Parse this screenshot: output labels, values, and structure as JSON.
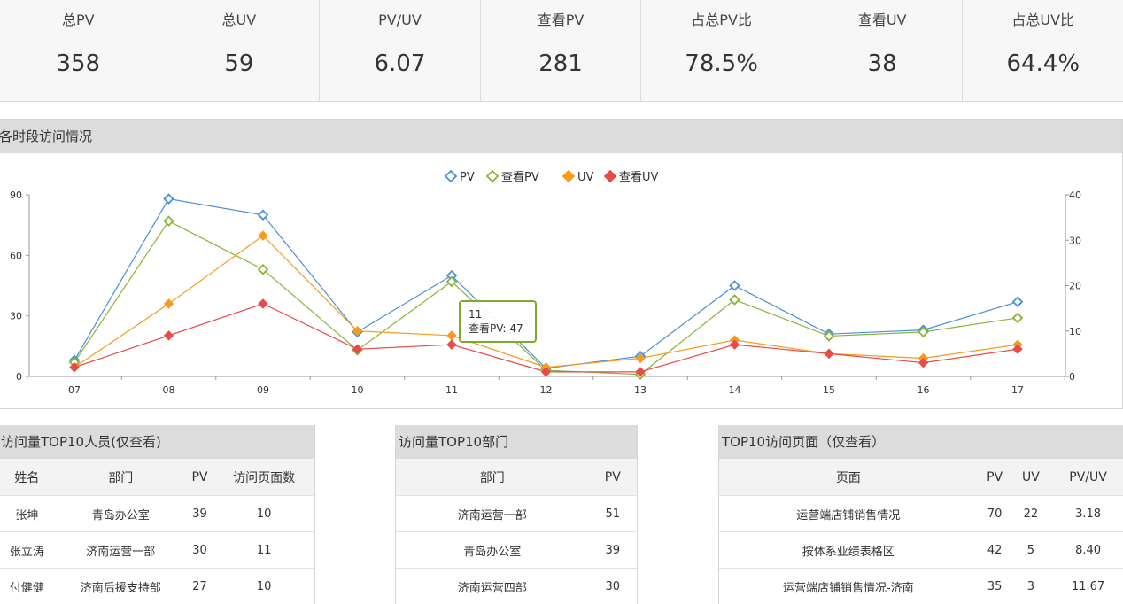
{
  "stats": [
    {
      "label": "总PV",
      "value": "358"
    },
    {
      "label": "总UV",
      "value": "59"
    },
    {
      "label": "PV/UV",
      "value": "6.07"
    },
    {
      "label": "查看PV",
      "value": "281"
    },
    {
      "label": "占总PV比",
      "value": "78.5%"
    },
    {
      "label": "查看UV",
      "value": "38"
    },
    {
      "label": "占总UV比",
      "value": "64.4%"
    }
  ],
  "chart_panel": {
    "title": "各时段访问情况"
  },
  "chart_data": {
    "type": "line",
    "categories": [
      "07",
      "08",
      "09",
      "10",
      "11",
      "12",
      "13",
      "14",
      "15",
      "16",
      "17"
    ],
    "y_left": {
      "ticks": [
        "0",
        "30",
        "60",
        "90"
      ],
      "ylim": [
        0,
        90
      ]
    },
    "y_right": {
      "ticks": [
        "0",
        "10",
        "20",
        "30",
        "40"
      ],
      "ylim": [
        0,
        40
      ]
    },
    "legend_position": "top-center",
    "series": [
      {
        "name": "PV",
        "color": "#4a90d9",
        "marker": "diamond-hollow",
        "axis": "left",
        "values": [
          8,
          88,
          80,
          22,
          50,
          4,
          10,
          45,
          21,
          23,
          37
        ]
      },
      {
        "name": "查看PV",
        "color": "#8ab33a",
        "marker": "diamond-hollow",
        "axis": "left",
        "values": [
          7,
          77,
          53,
          13,
          47,
          3,
          1,
          38,
          20,
          22,
          29
        ]
      },
      {
        "name": "UV",
        "color": "#f59c1e",
        "marker": "diamond-filled",
        "axis": "right",
        "values": [
          2,
          16,
          31,
          10,
          9,
          2,
          4,
          8,
          5,
          4,
          7
        ]
      },
      {
        "name": "查看UV",
        "color": "#e94b4b",
        "marker": "diamond-filled",
        "axis": "right",
        "values": [
          2,
          9,
          16,
          6,
          7,
          1,
          1,
          7,
          5,
          3,
          6
        ]
      }
    ],
    "tooltip": {
      "category": "11",
      "series": "查看PV",
      "value": 47,
      "text": "查看PV: 47"
    }
  },
  "tables": [
    {
      "title": "访问量TOP10人员(仅查看)",
      "headers": [
        "姓名",
        "部门",
        "PV",
        "访问页面数"
      ],
      "rows": [
        [
          "张坤",
          "青岛办公室",
          "39",
          "10"
        ],
        [
          "张立涛",
          "济南运营一部",
          "30",
          "11"
        ],
        [
          "付健健",
          "济南后援支持部",
          "27",
          "10"
        ]
      ]
    },
    {
      "title": "访问量TOP10部门",
      "headers": [
        "部门",
        "PV"
      ],
      "rows": [
        [
          "济南运营一部",
          "51"
        ],
        [
          "青岛办公室",
          "39"
        ],
        [
          "济南运营四部",
          "30"
        ]
      ]
    },
    {
      "title": "TOP10访问页面（仅查看）",
      "headers": [
        "页面",
        "PV",
        "UV",
        "PV/UV"
      ],
      "rows": [
        [
          "运营端店铺销售情况",
          "70",
          "22",
          "3.18"
        ],
        [
          "按体系业绩表格区",
          "42",
          "5",
          "8.40"
        ],
        [
          "运营端店铺销售情况-济南",
          "35",
          "3",
          "11.67"
        ]
      ]
    }
  ]
}
